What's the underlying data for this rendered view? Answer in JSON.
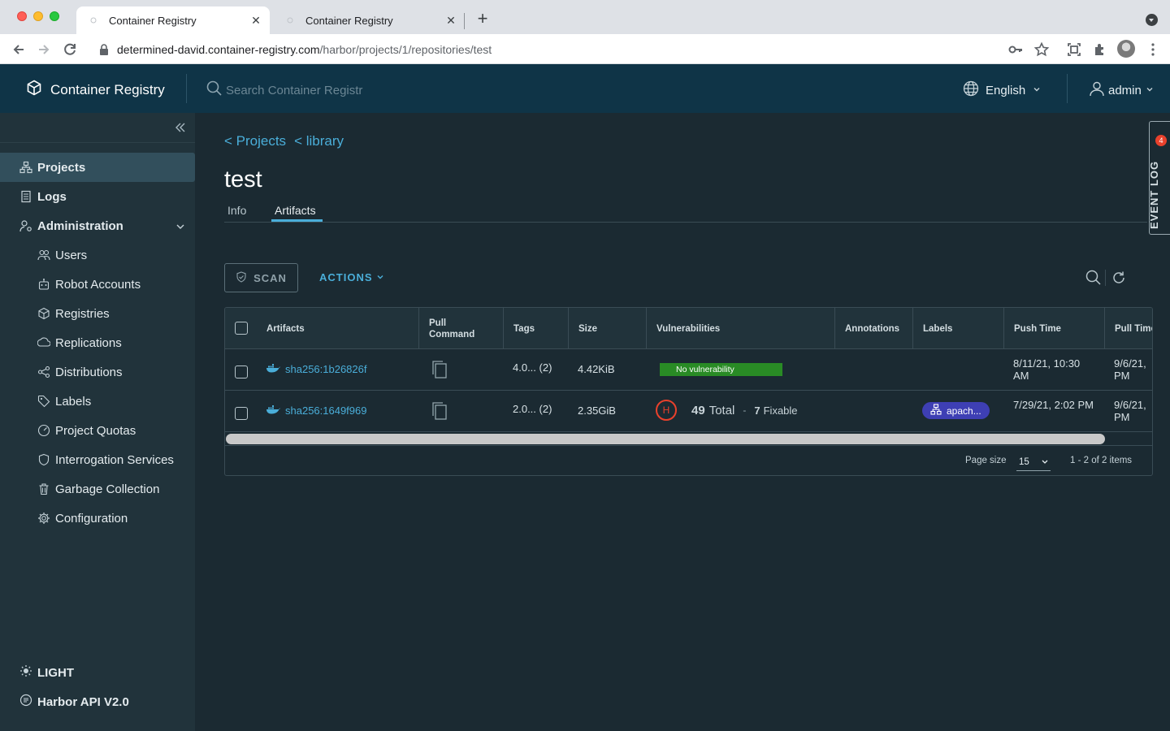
{
  "browser": {
    "tabs": [
      {
        "title": "Container Registry",
        "active": true
      },
      {
        "title": "Container Registry",
        "active": false
      }
    ],
    "url_host": "determined-david.container-registry.com",
    "url_path": "/harbor/projects/1/repositories/test"
  },
  "header": {
    "brand": "Container Registry",
    "search_placeholder": "Search Container Registr",
    "language": "English",
    "user": "admin"
  },
  "sidebar": {
    "items": [
      {
        "label": "Projects",
        "icon": "projects-icon",
        "active": true
      },
      {
        "label": "Logs",
        "icon": "logs-icon"
      },
      {
        "label": "Administration",
        "icon": "administration-icon"
      }
    ],
    "admin_items": [
      {
        "label": "Users",
        "icon": "users-icon"
      },
      {
        "label": "Robot Accounts",
        "icon": "robot-icon"
      },
      {
        "label": "Registries",
        "icon": "registries-icon"
      },
      {
        "label": "Replications",
        "icon": "replications-icon"
      },
      {
        "label": "Distributions",
        "icon": "distributions-icon"
      },
      {
        "label": "Labels",
        "icon": "labels-icon"
      },
      {
        "label": "Project Quotas",
        "icon": "quotas-icon"
      },
      {
        "label": "Interrogation Services",
        "icon": "shield-icon"
      },
      {
        "label": "Garbage Collection",
        "icon": "trash-icon"
      },
      {
        "label": "Configuration",
        "icon": "gear-icon"
      }
    ],
    "theme_label": "LIGHT",
    "api_label": "Harbor API V2.0"
  },
  "main": {
    "breadcrumbs": [
      "< Projects",
      "< library"
    ],
    "title": "test",
    "tabs": [
      "Info",
      "Artifacts"
    ],
    "active_tab": "Artifacts",
    "scan_label": "SCAN",
    "actions_label": "ACTIONS"
  },
  "table": {
    "headers": [
      "Artifacts",
      "Pull Command",
      "Tags",
      "Size",
      "Vulnerabilities",
      "Annotations",
      "Labels",
      "Push Time",
      "Pull Time"
    ],
    "rows": [
      {
        "digest": "sha256:1b26826f",
        "tags": "4.0... (2)",
        "size": "4.42KiB",
        "vuln_text": "No vulnerability",
        "push_time": "8/11/21, 10:30 AM",
        "pull_time": "9/6/21, PM"
      },
      {
        "digest": "sha256:1649f969",
        "tags": "2.0... (2)",
        "size": "2.35GiB",
        "severity": "H",
        "total_count": "49",
        "total_label": "Total",
        "dash": "-",
        "fixable_count": "7",
        "fixable_label": "Fixable",
        "label": "apach...",
        "push_time": "7/29/21, 2:02 PM",
        "pull_time": "9/6/21, PM"
      }
    ],
    "footer": {
      "page_size_label": "Page size",
      "page_size": "15",
      "range": "1 - 2 of 2 items"
    }
  },
  "event_log": {
    "label": "EVENT LOG",
    "badge": "4"
  },
  "colors": {
    "header_bg": "#0f3447",
    "sidebar_bg": "#21333b",
    "content_bg": "#1b2a32",
    "accent": "#4aaed9",
    "no_vuln_green": "#298b25",
    "high_red": "#e9412c",
    "label_purple": "#3e3fb4"
  }
}
